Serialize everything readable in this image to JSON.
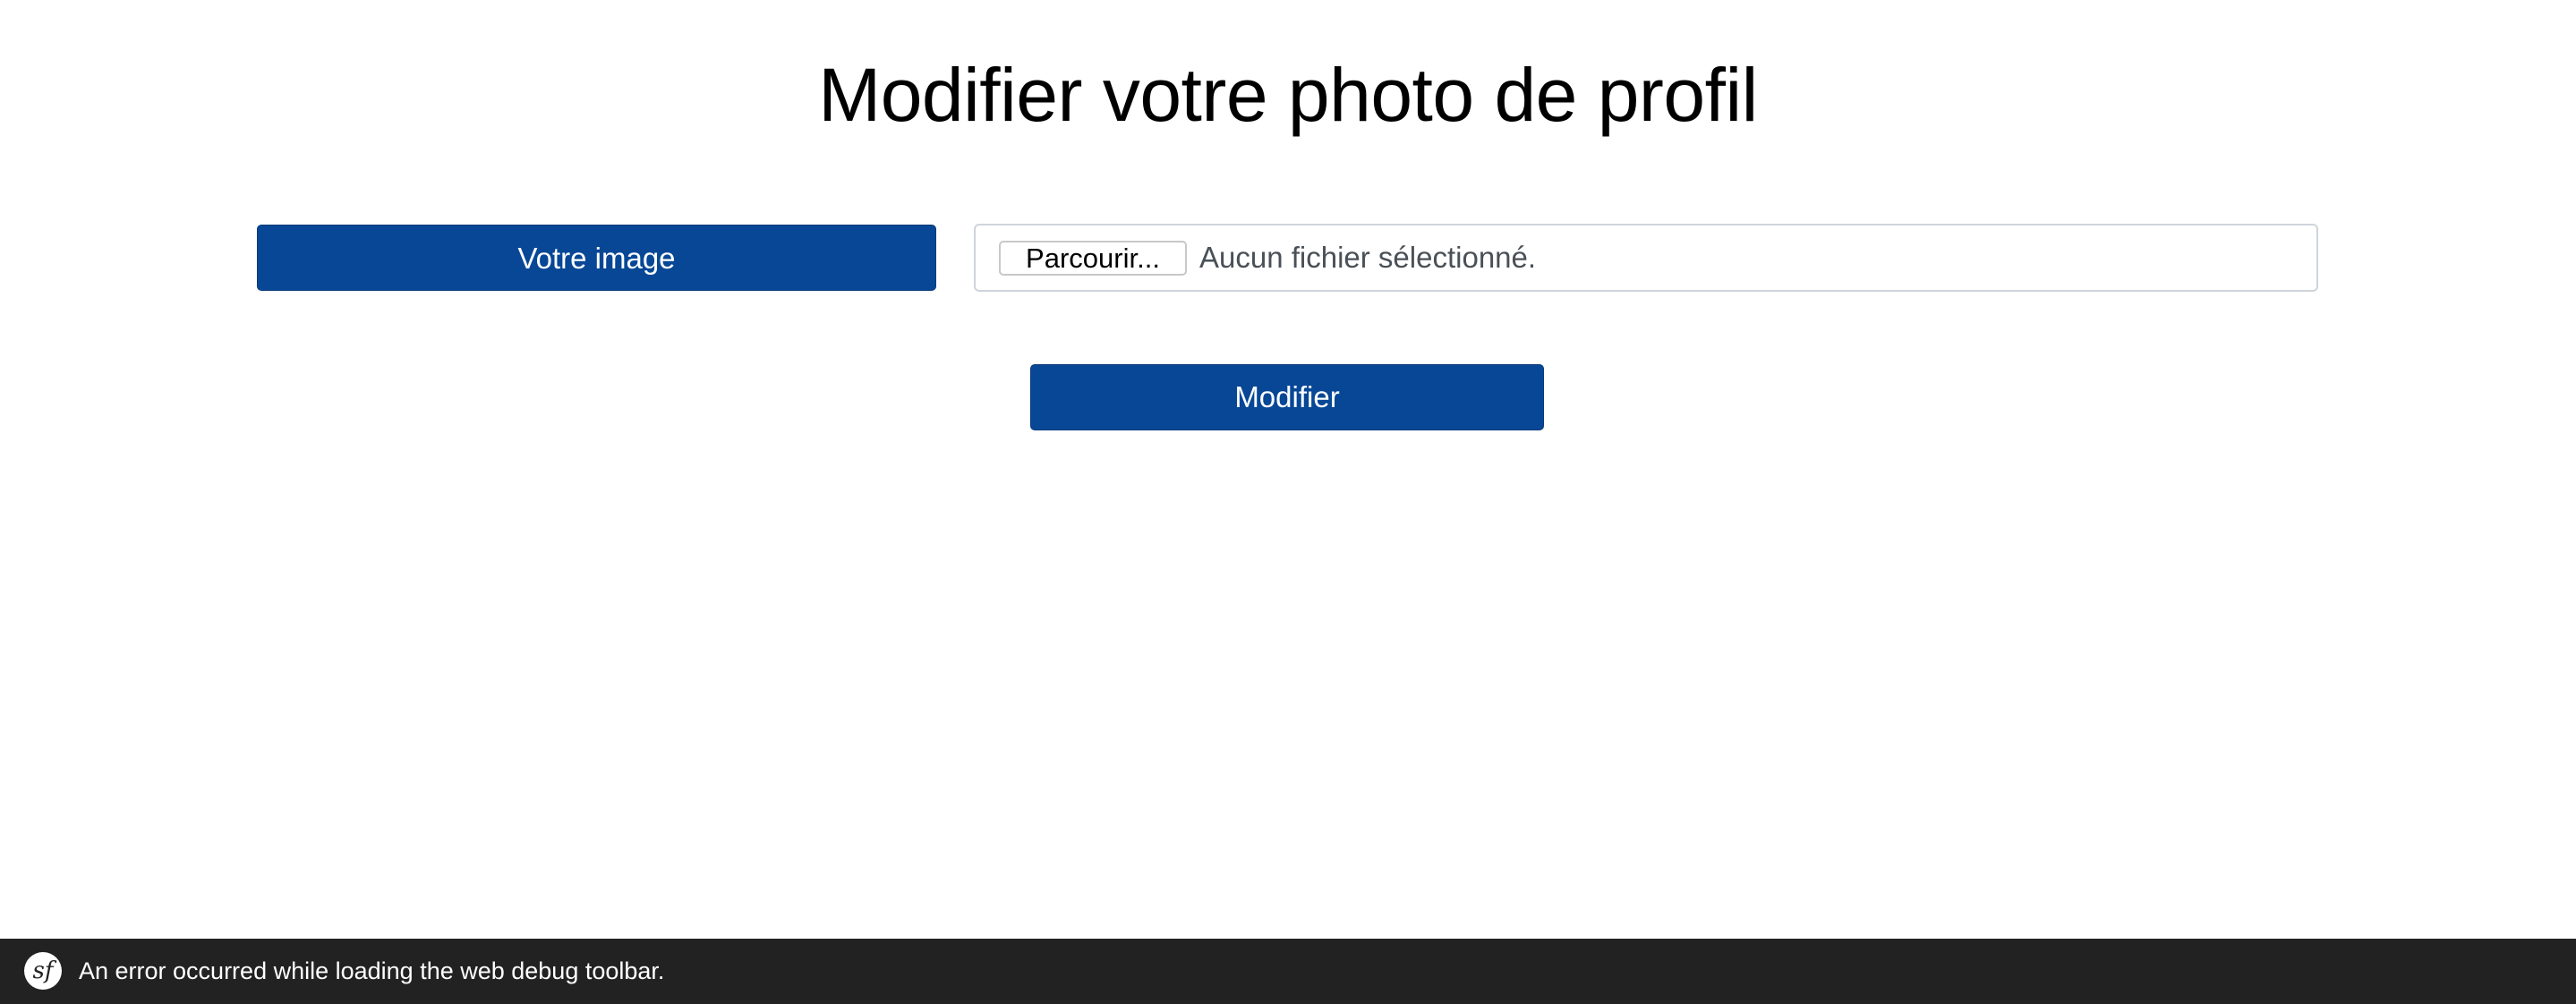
{
  "page": {
    "title": "Modifier votre photo de profil"
  },
  "form": {
    "image_label": "Votre image",
    "browse_label": "Parcourir...",
    "file_status": "Aucun fichier sélectionné.",
    "submit_label": "Modifier"
  },
  "debug_toolbar": {
    "logo_text": "sf",
    "logo_icon": "symfony-icon",
    "message": "An error occurred while loading the web debug toolbar."
  },
  "colors": {
    "primary": "#074796",
    "toolbar_bg": "#222222",
    "input_border": "#ced4da",
    "file_status_text": "#495057"
  }
}
